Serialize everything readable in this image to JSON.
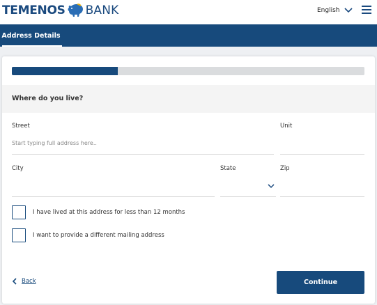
{
  "brand": {
    "name_bold": "TEMENOS",
    "name_light": "BANK",
    "logo_icon": "piggy-bank-icon",
    "color": "#1b4a7f"
  },
  "header": {
    "language": "English",
    "language_icon": "chevron-down-icon",
    "menu_icon": "hamburger-menu-icon"
  },
  "nav": {
    "active_tab": "Address Details",
    "color": "#174a7c"
  },
  "progress": {
    "value_fraction": 0.3
  },
  "form": {
    "section_title": "Where do you live?",
    "street": {
      "label": "Street",
      "value": "",
      "placeholder": "Start typing full address here.."
    },
    "unit": {
      "label": "Unit",
      "value": ""
    },
    "city": {
      "label": "City",
      "value": ""
    },
    "state": {
      "label": "State",
      "value": "",
      "icon": "chevron-down-icon"
    },
    "zip": {
      "label": "Zip",
      "value": ""
    },
    "checkboxes": [
      {
        "label": "I have lived at this address for less than 12 months",
        "checked": false
      },
      {
        "label": "I want to provide a different mailing address",
        "checked": false
      }
    ]
  },
  "footer": {
    "back_label": "Back",
    "back_icon": "chevron-left-icon",
    "continue_label": "Continue"
  }
}
